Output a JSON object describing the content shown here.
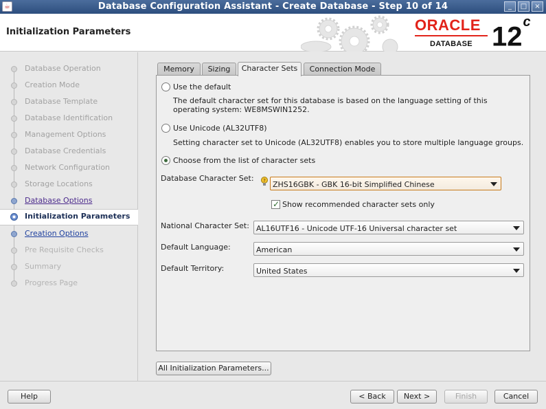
{
  "window": {
    "title": "Database Configuration Assistant - Create Database - Step 10 of 14",
    "controls": [
      "minimize",
      "maximize",
      "close"
    ]
  },
  "header": {
    "page_title": "Initialization Parameters",
    "logo_oracle": "ORACLE",
    "logo_database": "DATABASE",
    "version": "12",
    "version_sup": "c"
  },
  "nav": {
    "items": [
      {
        "label": "Database Operation",
        "state": "done"
      },
      {
        "label": "Creation Mode",
        "state": "done"
      },
      {
        "label": "Database Template",
        "state": "done"
      },
      {
        "label": "Database Identification",
        "state": "done"
      },
      {
        "label": "Management Options",
        "state": "done"
      },
      {
        "label": "Database Credentials",
        "state": "done"
      },
      {
        "label": "Network Configuration",
        "state": "done"
      },
      {
        "label": "Storage Locations",
        "state": "done"
      },
      {
        "label": "Database Options",
        "state": "link"
      },
      {
        "label": "Initialization Parameters",
        "state": "active"
      },
      {
        "label": "Creation Options",
        "state": "next"
      },
      {
        "label": "Pre Requisite Checks",
        "state": "disabled"
      },
      {
        "label": "Summary",
        "state": "disabled"
      },
      {
        "label": "Progress Page",
        "state": "disabled"
      }
    ]
  },
  "tabs": [
    {
      "label": "Memory",
      "selected": false
    },
    {
      "label": "Sizing",
      "selected": false
    },
    {
      "label": "Character Sets",
      "selected": true
    },
    {
      "label": "Connection Mode",
      "selected": false
    }
  ],
  "charset": {
    "opt_default_label": "Use the default",
    "opt_default_desc": "The default character set for this database is based on the language setting of this operating system: WE8MSWIN1252.",
    "opt_unicode_label": "Use Unicode (AL32UTF8)",
    "opt_unicode_desc": "Setting character set to Unicode (AL32UTF8) enables you to store multiple language groups.",
    "opt_choose_label": "Choose from the list of character sets",
    "selected_option": "choose",
    "db_charset_label": "Database Character Set:",
    "db_charset_value": "ZHS16GBK - GBK 16-bit Simplified Chinese",
    "show_recommended_label": "Show recommended character sets only",
    "show_recommended_checked": true,
    "national_label": "National Character Set:",
    "national_value": "AL16UTF16 - Unicode UTF-16 Universal character set",
    "language_label": "Default Language:",
    "language_value": "American",
    "territory_label": "Default Territory:",
    "territory_value": "United States"
  },
  "buttons": {
    "all_params": "All Initialization Parameters...",
    "help": "Help",
    "back": "< Back",
    "next": "Next >",
    "finish": "Finish",
    "cancel": "Cancel"
  }
}
